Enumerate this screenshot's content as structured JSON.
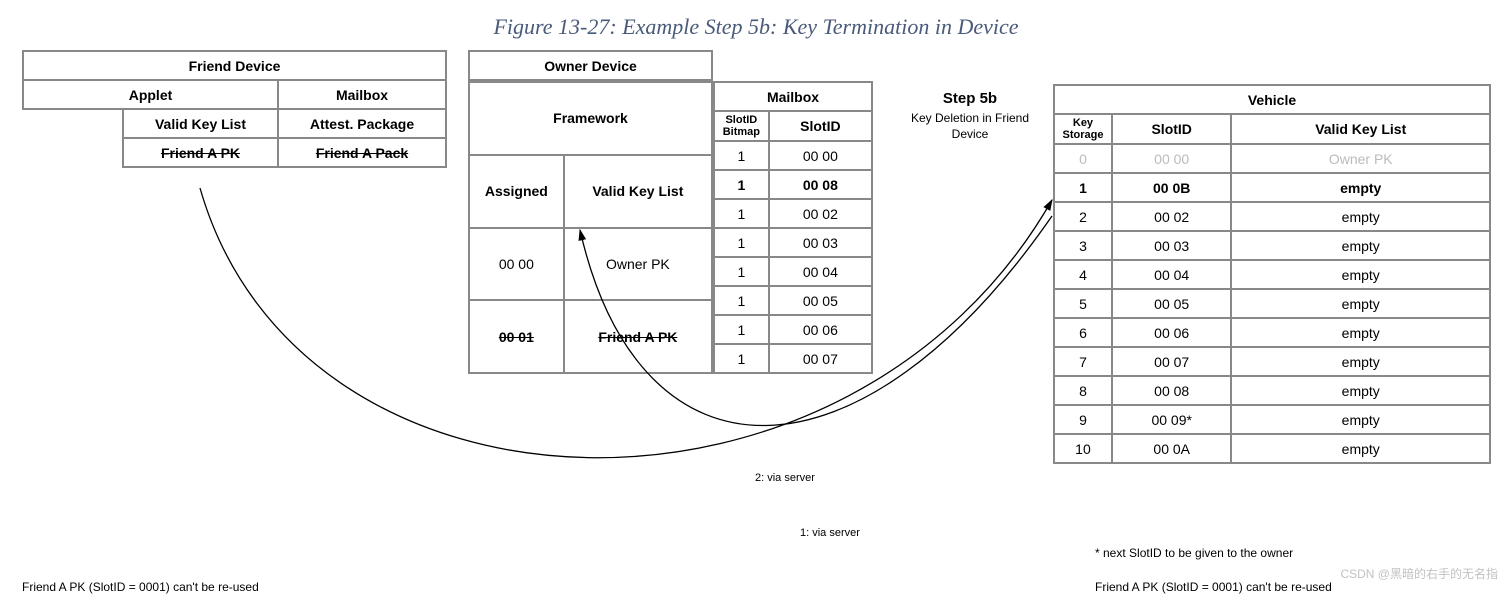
{
  "title": "Figure 13-27: Example Step 5b: Key Termination in Device",
  "step": {
    "heading": "Step 5b",
    "desc": "Key Deletion in Friend Device"
  },
  "friend": {
    "title": "Friend Device",
    "applet": {
      "title": "Applet",
      "col": "Valid Key List",
      "row": "Friend A PK"
    },
    "mailbox": {
      "title": "Mailbox",
      "col": "Attest. Package",
      "row": "Friend A Pack"
    }
  },
  "owner": {
    "title": "Owner Device",
    "framework": {
      "title": "Framework",
      "cols": {
        "assigned": "Assigned",
        "vkl": "Valid Key List"
      },
      "rows": [
        {
          "assigned": "00 00",
          "vkl": "Owner PK",
          "bold": false,
          "strike": false
        },
        {
          "assigned": "00 01",
          "vkl": "Friend A PK",
          "bold": true,
          "strike": true
        }
      ]
    },
    "mailbox": {
      "title": "Mailbox",
      "cols": {
        "bitmap": "SlotID Bitmap",
        "slot": "SlotID"
      },
      "rows": [
        {
          "b": "1",
          "s": "00 00",
          "bold": false
        },
        {
          "b": "1",
          "s": "00 08",
          "bold": true
        },
        {
          "b": "1",
          "s": "00 02",
          "bold": false
        },
        {
          "b": "1",
          "s": "00 03",
          "bold": false
        },
        {
          "b": "1",
          "s": "00 04",
          "bold": false
        },
        {
          "b": "1",
          "s": "00 05",
          "bold": false
        },
        {
          "b": "1",
          "s": "00 06",
          "bold": false
        },
        {
          "b": "1",
          "s": "00 07",
          "bold": false
        }
      ]
    }
  },
  "vehicle": {
    "title": "Vehicle",
    "cols": {
      "ks": "Key Storage",
      "slot": "SlotID",
      "vkl": "Valid Key List"
    },
    "rows": [
      {
        "ks": "0",
        "slot": "00 00",
        "vkl": "Owner PK",
        "dim": true,
        "bold": false
      },
      {
        "ks": "1",
        "slot": "00 0B",
        "vkl": "empty",
        "dim": false,
        "bold": true
      },
      {
        "ks": "2",
        "slot": "00 02",
        "vkl": "empty",
        "dim": false,
        "bold": false
      },
      {
        "ks": "3",
        "slot": "00 03",
        "vkl": "empty",
        "dim": false,
        "bold": false
      },
      {
        "ks": "4",
        "slot": "00 04",
        "vkl": "empty",
        "dim": false,
        "bold": false
      },
      {
        "ks": "5",
        "slot": "00 05",
        "vkl": "empty",
        "dim": false,
        "bold": false
      },
      {
        "ks": "6",
        "slot": "00 06",
        "vkl": "empty",
        "dim": false,
        "bold": false
      },
      {
        "ks": "7",
        "slot": "00 07",
        "vkl": "empty",
        "dim": false,
        "bold": false
      },
      {
        "ks": "8",
        "slot": "00 08",
        "vkl": "empty",
        "dim": false,
        "bold": false
      },
      {
        "ks": "9",
        "slot": "00 09*",
        "vkl": "empty",
        "dim": false,
        "bold": false
      },
      {
        "ks": "10",
        "slot": "00 0A",
        "vkl": "empty",
        "dim": false,
        "bold": false
      }
    ]
  },
  "arrows": {
    "a1": "1: via server",
    "a2": "2: via server"
  },
  "footnotes": {
    "left": "Friend A PK (SlotID = 0001) can't be re-used",
    "star": "* next SlotID to be given to the owner",
    "right": "Friend A PK (SlotID = 0001) can't be re-used"
  },
  "watermark": "CSDN @黑暗的右手的无名指"
}
